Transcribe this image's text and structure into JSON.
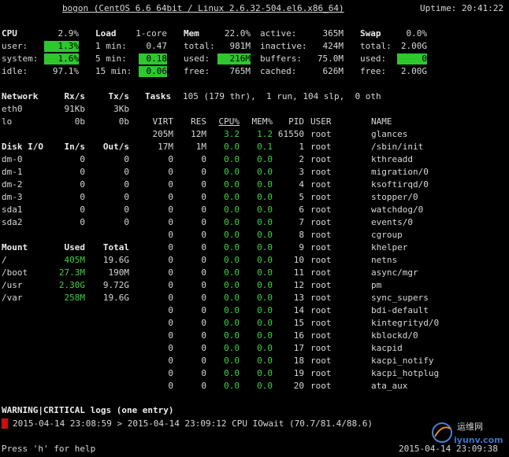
{
  "header": {
    "title": "bogon (CentOS 6.6 64bit / Linux 2.6.32-504.el6.x86_64)",
    "uptime": "Uptime: 20:41:22"
  },
  "cpu": {
    "title": "CPU",
    "total": "2.9%",
    "rows": [
      {
        "label": "user:",
        "value": "1.3%"
      },
      {
        "label": "system:",
        "value": "1.6%"
      },
      {
        "label": "idle:",
        "value": "97.1%"
      }
    ]
  },
  "load": {
    "title": "Load",
    "cores": "1-core",
    "rows": [
      {
        "label": "1 min:",
        "value": "0.47"
      },
      {
        "label": "5 min:",
        "value": "0.18"
      },
      {
        "label": "15 min:",
        "value": "0.06"
      }
    ]
  },
  "mem": {
    "title": "Mem",
    "percent": "22.0%",
    "rows": [
      {
        "label": "total:",
        "value": "981M"
      },
      {
        "label": "used:",
        "value": "216M"
      },
      {
        "label": "free:",
        "value": "765M"
      }
    ]
  },
  "mem2": {
    "rows": [
      {
        "label": "active:",
        "value": "365M"
      },
      {
        "label": "inactive:",
        "value": "424M"
      },
      {
        "label": "buffers:",
        "value": "75.0M"
      },
      {
        "label": "cached:",
        "value": "626M"
      }
    ]
  },
  "swap": {
    "title": "Swap",
    "percent": "0.0%",
    "rows": [
      {
        "label": "total:",
        "value": "2.00G"
      },
      {
        "label": "used:",
        "value": "0"
      },
      {
        "label": "free:",
        "value": "2.00G"
      }
    ]
  },
  "network": {
    "headers": [
      "Network",
      "Rx/s",
      "Tx/s"
    ],
    "rows": [
      [
        "eth0",
        "91Kb",
        "3Kb"
      ],
      [
        "lo",
        "0b",
        "0b"
      ]
    ]
  },
  "tasks": {
    "label": "Tasks",
    "summary": "105 (179 thr),  1 run, 104 slp,  0 oth"
  },
  "diskio": {
    "headers": [
      "Disk I/O",
      "In/s",
      "Out/s"
    ],
    "rows": [
      [
        "dm-0",
        "0",
        "0"
      ],
      [
        "dm-1",
        "0",
        "0"
      ],
      [
        "dm-2",
        "0",
        "0"
      ],
      [
        "dm-3",
        "0",
        "0"
      ],
      [
        "sda1",
        "0",
        "0"
      ],
      [
        "sda2",
        "0",
        "0"
      ]
    ]
  },
  "mount": {
    "headers": [
      "Mount",
      "Used",
      "Total"
    ],
    "rows": [
      [
        "/",
        "405M",
        "19.6G"
      ],
      [
        "/boot",
        "27.3M",
        "190M"
      ],
      [
        "/usr",
        "2.30G",
        "9.72G"
      ],
      [
        "/var",
        "258M",
        "19.6G"
      ]
    ]
  },
  "process": {
    "headers": [
      "VIRT",
      "RES",
      "CPU%",
      "MEM%",
      "PID",
      "USER",
      "NAME"
    ],
    "rows": [
      [
        "205M",
        "12M",
        "3.2",
        "1.2",
        "61550",
        "root",
        "glances"
      ],
      [
        "17M",
        "1M",
        "0.0",
        "0.1",
        "1",
        "root",
        "/sbin/init"
      ],
      [
        "0",
        "0",
        "0.0",
        "0.0",
        "2",
        "root",
        "kthreadd"
      ],
      [
        "0",
        "0",
        "0.0",
        "0.0",
        "3",
        "root",
        "migration/0"
      ],
      [
        "0",
        "0",
        "0.0",
        "0.0",
        "4",
        "root",
        "ksoftirqd/0"
      ],
      [
        "0",
        "0",
        "0.0",
        "0.0",
        "5",
        "root",
        "stopper/0"
      ],
      [
        "0",
        "0",
        "0.0",
        "0.0",
        "6",
        "root",
        "watchdog/0"
      ],
      [
        "0",
        "0",
        "0.0",
        "0.0",
        "7",
        "root",
        "events/0"
      ],
      [
        "0",
        "0",
        "0.0",
        "0.0",
        "8",
        "root",
        "cgroup"
      ],
      [
        "0",
        "0",
        "0.0",
        "0.0",
        "9",
        "root",
        "khelper"
      ],
      [
        "0",
        "0",
        "0.0",
        "0.0",
        "10",
        "root",
        "netns"
      ],
      [
        "0",
        "0",
        "0.0",
        "0.0",
        "11",
        "root",
        "async/mgr"
      ],
      [
        "0",
        "0",
        "0.0",
        "0.0",
        "12",
        "root",
        "pm"
      ],
      [
        "0",
        "0",
        "0.0",
        "0.0",
        "13",
        "root",
        "sync_supers"
      ],
      [
        "0",
        "0",
        "0.0",
        "0.0",
        "14",
        "root",
        "bdi-default"
      ],
      [
        "0",
        "0",
        "0.0",
        "0.0",
        "15",
        "root",
        "kintegrityd/0"
      ],
      [
        "0",
        "0",
        "0.0",
        "0.0",
        "16",
        "root",
        "kblockd/0"
      ],
      [
        "0",
        "0",
        "0.0",
        "0.0",
        "17",
        "root",
        "kacpid"
      ],
      [
        "0",
        "0",
        "0.0",
        "0.0",
        "18",
        "root",
        "kacpi_notify"
      ],
      [
        "0",
        "0",
        "0.0",
        "0.0",
        "19",
        "root",
        "kacpi_hotplug"
      ],
      [
        "0",
        "0",
        "0.0",
        "0.0",
        "20",
        "root",
        "ata_aux"
      ]
    ]
  },
  "logs": {
    "title": "WARNING|CRITICAL logs (one entry)",
    "entry": "2015-04-14 23:08:59 > 2015-04-14 23:09:12 CPU IOwait (70.7/81.4/88.6)"
  },
  "footer": {
    "help": "Press 'h' for help",
    "datetime": "2015-04-14 23:09:38"
  },
  "watermark": {
    "brand": "运维网",
    "url": "iyunv.com"
  },
  "colors": {
    "accent": "#2ec72e",
    "green_text": "#3fd23f",
    "critical": "#c81010",
    "background": "#000000"
  }
}
